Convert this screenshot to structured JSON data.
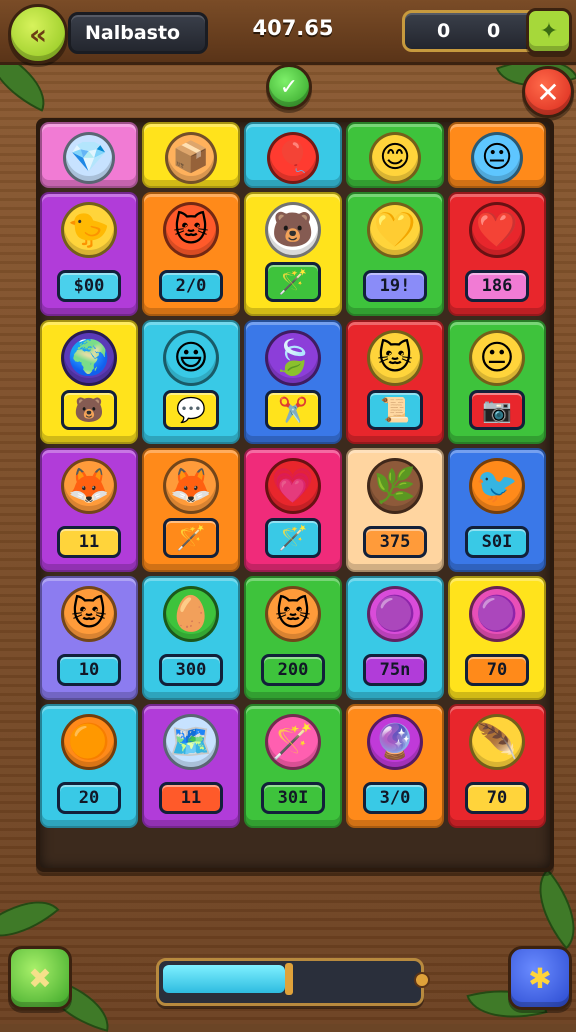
{
  "topbar": {
    "player_name": "Nalbasto",
    "score": "407.65",
    "counter_left": "0",
    "counter_right": "0"
  },
  "progress": {
    "fraction": 0.49
  },
  "palette": {
    "pink": "#f17bd4",
    "yellow": "#ffe31c",
    "cyan": "#39c9e6",
    "green": "#3ec33c",
    "orange": "#ff8a1a",
    "purple": "#b13cd9",
    "red": "#e8262c",
    "blue": "#3a78e8",
    "violet": "#8c7cf0",
    "lime": "#b7e13a"
  },
  "board": {
    "rows": [
      [
        {
          "color": "#f17bd4",
          "icon": "crystal-icon",
          "glyph": "💎",
          "icon_bg": "#c7e2ff",
          "label": ""
        },
        {
          "color": "#ffe31c",
          "icon": "crate-icon",
          "glyph": "📦",
          "icon_bg": "#ffb15c",
          "label": ""
        },
        {
          "color": "#39c9e6",
          "icon": "balloon-icon",
          "glyph": "🎈",
          "icon_bg": "#ff3b30",
          "label": ""
        },
        {
          "color": "#3ec33c",
          "icon": "smiley-icon",
          "glyph": "😊",
          "icon_bg": "#ffd43b",
          "label": ""
        },
        {
          "color": "#ff8a1a",
          "icon": "blue-face-icon",
          "glyph": "😐",
          "icon_bg": "#5ec6ff",
          "label": ""
        }
      ],
      [
        {
          "color": "#b13cd9",
          "icon": "chick-icon",
          "glyph": "🐤",
          "icon_bg": "#ffd43b",
          "label": "$00",
          "label_bg": "#4ad0ec"
        },
        {
          "color": "#ff8a1a",
          "icon": "cowboy-cat-icon",
          "glyph": "🐱",
          "icon_bg": "#ff5a2a",
          "label": "2/0",
          "label_bg": "#39c9e6"
        },
        {
          "color": "#ffe31c",
          "icon": "white-bear-icon",
          "glyph": "🐻",
          "icon_bg": "#ffffff",
          "label": "wand",
          "label_bg": "#3ec33c"
        },
        {
          "color": "#3ec33c",
          "icon": "heart-fruit-icon",
          "glyph": "💛",
          "icon_bg": "#ffd43b",
          "label": "19!",
          "label_bg": "#8a8cf8"
        },
        {
          "color": "#e8262c",
          "icon": "heart-icon",
          "glyph": "❤️",
          "icon_bg": "#e8262c",
          "label": "186",
          "label_bg": "#f17bd4"
        }
      ],
      [
        {
          "color": "#ffe31c",
          "icon": "globe-icon",
          "glyph": "🌍",
          "icon_bg": "#5a3ab8",
          "label": "bear",
          "label_bg": "#ffe31c"
        },
        {
          "color": "#39c9e6",
          "icon": "blue-monster-icon",
          "glyph": "😃",
          "icon_bg": "#39c9e6",
          "label": "speech",
          "label_bg": "#ffe31c"
        },
        {
          "color": "#3a78e8",
          "icon": "leaf-icon",
          "glyph": "🍃",
          "icon_bg": "#8c3ed9",
          "label": "scissors",
          "label_bg": "#ffe31c"
        },
        {
          "color": "#e8262c",
          "icon": "cat-slash-icon",
          "glyph": "🐱",
          "icon_bg": "#ffd43b",
          "label": "scroll",
          "label_bg": "#39c9e6"
        },
        {
          "color": "#3ec33c",
          "icon": "yellow-face-icon",
          "glyph": "😐",
          "icon_bg": "#ffd43b",
          "label": "camera",
          "label_bg": "#e8262c"
        }
      ],
      [
        {
          "color": "#b13cd9",
          "icon": "fox-icon",
          "glyph": "🦊",
          "icon_bg": "#ff9b3a",
          "label": "11",
          "label_bg": "#ffd43b"
        },
        {
          "color": "#ff8a1a",
          "icon": "fox-icon",
          "glyph": "🦊",
          "icon_bg": "#ff9b3a",
          "label": "wand",
          "label_bg": "#ff8a1a"
        },
        {
          "color": "#f02b7a",
          "icon": "heart-icon",
          "glyph": "💗",
          "icon_bg": "#e8262c",
          "label": "wand",
          "label_bg": "#39c9e6"
        },
        {
          "color": "#ffd5a0",
          "icon": "bush-creature-icon",
          "glyph": "🌿",
          "icon_bg": "#8e5a3a",
          "label": "375",
          "label_bg": "#ff9b3a"
        },
        {
          "color": "#3a78e8",
          "icon": "orange-bird-icon",
          "glyph": "🐦",
          "icon_bg": "#ff8a1a",
          "label": "S0I",
          "label_bg": "#39c9e6"
        }
      ],
      [
        {
          "color": "#8c7cf0",
          "icon": "cat-icon",
          "glyph": "🐱",
          "icon_bg": "#ff9b3a",
          "label": "10",
          "label_bg": "#39c9e6"
        },
        {
          "color": "#39c9e6",
          "icon": "striped-egg-icon",
          "glyph": "🥚",
          "icon_bg": "#3ec33c",
          "label": "300",
          "label_bg": "#39c9e6"
        },
        {
          "color": "#3ec33c",
          "icon": "cat-icon",
          "glyph": "🐱",
          "icon_bg": "#ff9b3a",
          "label": "200",
          "label_bg": "#3ec33c"
        },
        {
          "color": "#39c9e6",
          "icon": "purple-ring-icon",
          "glyph": "🟣",
          "icon_bg": "#d94cd9",
          "label": "75n",
          "label_bg": "#b13cd9"
        },
        {
          "color": "#ffe31c",
          "icon": "pink-blob-icon",
          "glyph": "🟣",
          "icon_bg": "#e84fb8",
          "label": "70",
          "label_bg": "#ff8a1a"
        }
      ],
      [
        {
          "color": "#39c9e6",
          "icon": "orange-ball-icon",
          "glyph": "🟠",
          "icon_bg": "#ff8a1a",
          "label": "20",
          "label_bg": "#39c9e6"
        },
        {
          "color": "#b13cd9",
          "icon": "map-board-icon",
          "glyph": "🗺️",
          "icon_bg": "#c7e2ff",
          "label": "11",
          "label_bg": "#ff5a2a"
        },
        {
          "color": "#3ec33c",
          "icon": "pink-pick-icon",
          "glyph": "🪄",
          "icon_bg": "#ff5fb0",
          "label": "30I",
          "label_bg": "#3ec33c"
        },
        {
          "color": "#ff8a1a",
          "icon": "purple-gem-icon",
          "glyph": "🔮",
          "icon_bg": "#c03ad9",
          "label": "3/0",
          "label_bg": "#39c9e6"
        },
        {
          "color": "#e8262c",
          "icon": "golden-feather-icon",
          "glyph": "🪶",
          "icon_bg": "#ffd43b",
          "label": "70",
          "label_bg": "#ffd43b"
        }
      ]
    ]
  }
}
